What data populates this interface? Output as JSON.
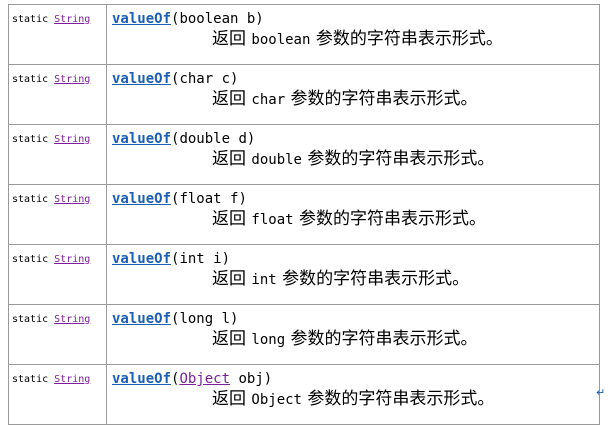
{
  "rows": [
    {
      "modifier": "static",
      "return_type": "String",
      "method": "valueOf",
      "params_pre": "(boolean b)",
      "param_link": "",
      "params_post": "",
      "desc_prefix": "返回",
      "desc_type": "boolean",
      "desc_suffix": "参数的字符串表示形式。"
    },
    {
      "modifier": "static",
      "return_type": "String",
      "method": "valueOf",
      "params_pre": "(char c)",
      "param_link": "",
      "params_post": "",
      "desc_prefix": "返回",
      "desc_type": "char",
      "desc_suffix": "参数的字符串表示形式。"
    },
    {
      "modifier": "static",
      "return_type": "String",
      "method": "valueOf",
      "params_pre": "(double d)",
      "param_link": "",
      "params_post": "",
      "desc_prefix": "返回",
      "desc_type": "double",
      "desc_suffix": "参数的字符串表示形式。"
    },
    {
      "modifier": "static",
      "return_type": "String",
      "method": "valueOf",
      "params_pre": "(float f)",
      "param_link": "",
      "params_post": "",
      "desc_prefix": "返回",
      "desc_type": "float",
      "desc_suffix": "参数的字符串表示形式。"
    },
    {
      "modifier": "static",
      "return_type": "String",
      "method": "valueOf",
      "params_pre": "(int i)",
      "param_link": "",
      "params_post": "",
      "desc_prefix": "返回",
      "desc_type": "int",
      "desc_suffix": "参数的字符串表示形式。"
    },
    {
      "modifier": "static",
      "return_type": "String",
      "method": "valueOf",
      "params_pre": "(long l)",
      "param_link": "",
      "params_post": "",
      "desc_prefix": "返回",
      "desc_type": "long",
      "desc_suffix": "参数的字符串表示形式。"
    },
    {
      "modifier": "static",
      "return_type": "String",
      "method": "valueOf",
      "params_pre": "(",
      "param_link": "Object",
      "params_post": " obj)",
      "desc_prefix": "返回",
      "desc_type": "Object",
      "desc_suffix": "参数的字符串表示形式。"
    }
  ]
}
